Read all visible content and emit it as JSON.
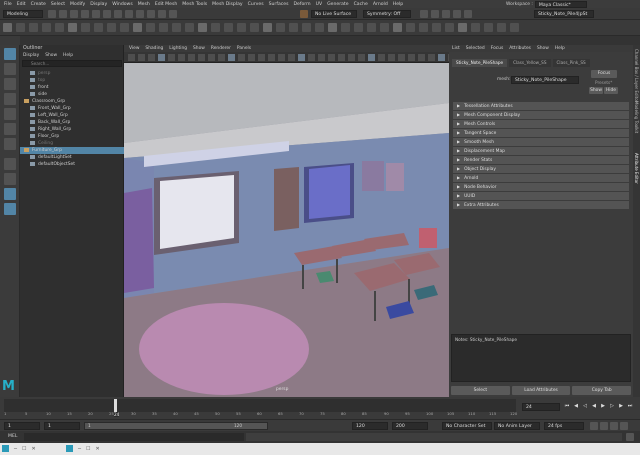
{
  "menus": [
    "File",
    "Edit",
    "Create",
    "Select",
    "Modify",
    "Display",
    "Windows",
    "Mesh",
    "Edit Mesh",
    "Mesh Tools",
    "Mesh Display",
    "Curves",
    "Surfaces",
    "Deform",
    "UV",
    "Generate",
    "Cache",
    "Arnold",
    "Help"
  ],
  "workspace": {
    "label": "Workspace :",
    "value": "Maya Classic*"
  },
  "toolbar": {
    "mode": "Modeling",
    "no_live_surface": "No Live Surface",
    "symmetry": "Symmetry: Off",
    "search_value": "Sticky_Note_Pile4|pSt"
  },
  "outliner": {
    "title": "Outliner",
    "menus": [
      "Display",
      "Show",
      "Help"
    ],
    "search_placeholder": "Search...",
    "items": [
      {
        "label": "persp",
        "indent": 1,
        "dim": true
      },
      {
        "label": "top",
        "indent": 1,
        "dim": true
      },
      {
        "label": "front",
        "indent": 1,
        "dim": false
      },
      {
        "label": "side",
        "indent": 1,
        "dim": false
      },
      {
        "label": "Classroom_Grp",
        "indent": 0,
        "dim": false
      },
      {
        "label": "Front_Wall_Grp",
        "indent": 1,
        "dim": false
      },
      {
        "label": "Left_Wall_Grp",
        "indent": 1,
        "dim": false
      },
      {
        "label": "Back_Wall_Grp",
        "indent": 1,
        "dim": false
      },
      {
        "label": "Right_Wall_Grp",
        "indent": 1,
        "dim": false
      },
      {
        "label": "Floor_Grp",
        "indent": 1,
        "dim": false
      },
      {
        "label": "Ceiling",
        "indent": 1,
        "dim": true
      },
      {
        "label": "Furniture_Grp",
        "indent": 0,
        "dim": false,
        "selected": true
      },
      {
        "label": "defaultLightSet",
        "indent": 1,
        "dim": false
      },
      {
        "label": "defaultObjectSet",
        "indent": 1,
        "dim": false
      }
    ]
  },
  "viewport": {
    "menus": [
      "View",
      "Shading",
      "Lighting",
      "Show",
      "Renderer",
      "Panels"
    ],
    "camera_label": "persp"
  },
  "attribute_editor": {
    "menus": [
      "List",
      "Selected",
      "Focus",
      "Attributes",
      "Show",
      "Help"
    ],
    "tabs": [
      "Sticky_Note_PileShape",
      "Class_Yellow_SS",
      "Class_Pink_SS"
    ],
    "mesh_label": "mesh:",
    "mesh_value": "Sticky_Note_PileShape",
    "buttons": {
      "focus": "Focus",
      "presets": "Presets*",
      "show": "Show",
      "hide": "Hide"
    },
    "sections": [
      "Tessellation Attributes",
      "Mesh Component Display",
      "Mesh Controls",
      "Tangent Space",
      "Smooth Mesh",
      "Displacement Map",
      "Render Stats",
      "Object Display",
      "Arnold",
      "Node Behavior",
      "UUID",
      "Extra Attributes"
    ],
    "notes": "Notes:  Sticky_Note_PileShape",
    "bottom_buttons": [
      "Select",
      "Load Attributes",
      "Copy Tab"
    ]
  },
  "right_tabs": [
    "Channel Box / Layer Editor",
    "Modeling Toolkit",
    "Attribute Editor"
  ],
  "timeline": {
    "ticks": [
      "1",
      "5",
      "10",
      "15",
      "20",
      "25",
      "30",
      "35",
      "40",
      "45",
      "50",
      "55",
      "60",
      "65",
      "70",
      "75",
      "80",
      "85",
      "90",
      "95",
      "100",
      "105",
      "110",
      "115",
      "120"
    ],
    "current_frame": "24",
    "current_frame_marker": "24"
  },
  "range": {
    "start": "1",
    "start2": "1",
    "mid": "1",
    "end_slider": "120",
    "end": "120",
    "end2": "200",
    "character_set": "No Character Set",
    "anim_layer": "No Anim Layer",
    "fps": "24 fps"
  },
  "mel_label": "MEL",
  "colors": {
    "selected": "#5285a6",
    "accent_blue": "#2b6fa8"
  }
}
